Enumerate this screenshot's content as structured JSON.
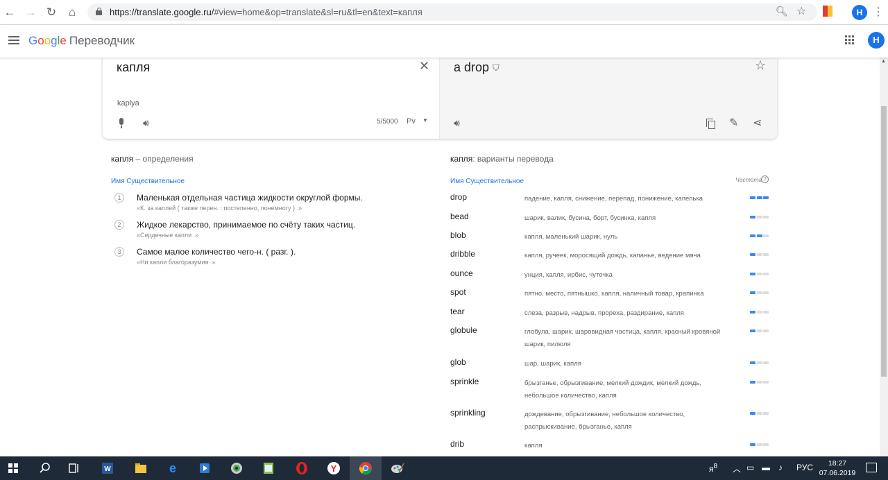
{
  "browser": {
    "url_host": "https://translate.google.ru/",
    "url_rest": "#view=home&op=translate&sl=ru&tl=en&text=капля",
    "profile_initial": "H"
  },
  "app": {
    "logo_letters": [
      "G",
      "o",
      "o",
      "g",
      "l",
      "e"
    ],
    "product_name": "Переводчик",
    "profile_initial": "H"
  },
  "source": {
    "text": "капля",
    "transliteration": "kaplya",
    "char_count": "5/5000",
    "keyboard_label": "Рv"
  },
  "target": {
    "text": "a drop"
  },
  "definitions": {
    "title_word": "капля",
    "title_rest": " – определения",
    "pos": "Имя Существительное",
    "items": [
      {
        "num": "1",
        "text": "Маленькая отдельная частица жидкости округлой формы.",
        "example": "«К. за каплей ( также перен. : постепенно, понемногу ) .»"
      },
      {
        "num": "2",
        "text": "Жидкое лекарство, принимаемое по счёту таких частиц.",
        "example": "«Сердечные капли .»"
      },
      {
        "num": "3",
        "text": "Самое малое количество чего-н. ( разг. ).",
        "example": "«Ни капли благоразумия .»"
      }
    ]
  },
  "translations": {
    "title_word": "капля",
    "title_rest": ": варианты перевода",
    "pos": "Имя Существительное",
    "freq_label": "Частота",
    "rows": [
      {
        "word": "drop",
        "back": "падение, капля, снижение, перепад, понижение, капелька",
        "freq": 3
      },
      {
        "word": "bead",
        "back": "шарик, валик, бусина, борт, бусинка, капля",
        "freq": 1
      },
      {
        "word": "blob",
        "back": "капля, маленький шарик, нуль",
        "freq": 2
      },
      {
        "word": "dribble",
        "back": "капля, ручеек, моросящий дождь, капанье, ведение мяча",
        "freq": 1
      },
      {
        "word": "ounce",
        "back": "унция, капля, ирбис, чуточка",
        "freq": 1
      },
      {
        "word": "spot",
        "back": "пятно, место, пятнышко, капля, наличный товар, крапинка",
        "freq": 1
      },
      {
        "word": "tear",
        "back": "слеза, разрыв, надрыв, прореха, раздирание, капля",
        "freq": 1
      },
      {
        "word": "globule",
        "back": "глобула, шарик, шаровидная частица, капля, красный кровяной шарик, пилюля",
        "freq": 1
      },
      {
        "word": "glob",
        "back": "шар, шарик, капля",
        "freq": 1
      },
      {
        "word": "sprinkle",
        "back": "брызганье, обрызгивание, мелкий дождик, мелкий дождь, небольшое количество, капля",
        "freq": 1
      },
      {
        "word": "sprinkling",
        "back": "дождевание, обрызгивание, небольшое количество, распрыскивание, брызганье, капля",
        "freq": 1
      },
      {
        "word": "drib",
        "back": "капля",
        "freq": 1
      }
    ]
  },
  "taskbar": {
    "language": "РУС",
    "time": "18:27",
    "date": "07.06.2019"
  }
}
